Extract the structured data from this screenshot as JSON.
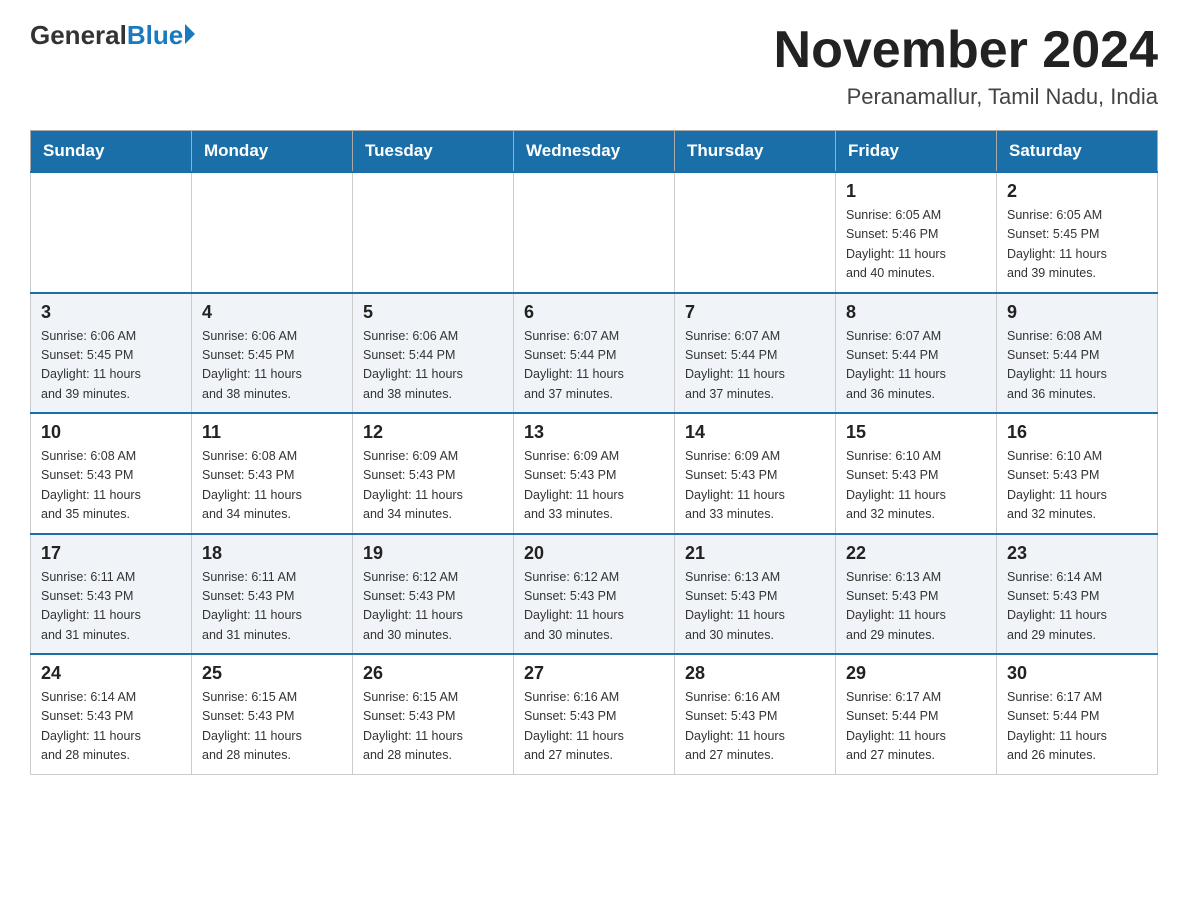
{
  "header": {
    "logo_general": "General",
    "logo_blue": "Blue",
    "month_title": "November 2024",
    "location": "Peranamallur, Tamil Nadu, India"
  },
  "weekdays": [
    "Sunday",
    "Monday",
    "Tuesday",
    "Wednesday",
    "Thursday",
    "Friday",
    "Saturday"
  ],
  "weeks": [
    [
      {
        "day": "",
        "info": ""
      },
      {
        "day": "",
        "info": ""
      },
      {
        "day": "",
        "info": ""
      },
      {
        "day": "",
        "info": ""
      },
      {
        "day": "",
        "info": ""
      },
      {
        "day": "1",
        "info": "Sunrise: 6:05 AM\nSunset: 5:46 PM\nDaylight: 11 hours\nand 40 minutes."
      },
      {
        "day": "2",
        "info": "Sunrise: 6:05 AM\nSunset: 5:45 PM\nDaylight: 11 hours\nand 39 minutes."
      }
    ],
    [
      {
        "day": "3",
        "info": "Sunrise: 6:06 AM\nSunset: 5:45 PM\nDaylight: 11 hours\nand 39 minutes."
      },
      {
        "day": "4",
        "info": "Sunrise: 6:06 AM\nSunset: 5:45 PM\nDaylight: 11 hours\nand 38 minutes."
      },
      {
        "day": "5",
        "info": "Sunrise: 6:06 AM\nSunset: 5:44 PM\nDaylight: 11 hours\nand 38 minutes."
      },
      {
        "day": "6",
        "info": "Sunrise: 6:07 AM\nSunset: 5:44 PM\nDaylight: 11 hours\nand 37 minutes."
      },
      {
        "day": "7",
        "info": "Sunrise: 6:07 AM\nSunset: 5:44 PM\nDaylight: 11 hours\nand 37 minutes."
      },
      {
        "day": "8",
        "info": "Sunrise: 6:07 AM\nSunset: 5:44 PM\nDaylight: 11 hours\nand 36 minutes."
      },
      {
        "day": "9",
        "info": "Sunrise: 6:08 AM\nSunset: 5:44 PM\nDaylight: 11 hours\nand 36 minutes."
      }
    ],
    [
      {
        "day": "10",
        "info": "Sunrise: 6:08 AM\nSunset: 5:43 PM\nDaylight: 11 hours\nand 35 minutes."
      },
      {
        "day": "11",
        "info": "Sunrise: 6:08 AM\nSunset: 5:43 PM\nDaylight: 11 hours\nand 34 minutes."
      },
      {
        "day": "12",
        "info": "Sunrise: 6:09 AM\nSunset: 5:43 PM\nDaylight: 11 hours\nand 34 minutes."
      },
      {
        "day": "13",
        "info": "Sunrise: 6:09 AM\nSunset: 5:43 PM\nDaylight: 11 hours\nand 33 minutes."
      },
      {
        "day": "14",
        "info": "Sunrise: 6:09 AM\nSunset: 5:43 PM\nDaylight: 11 hours\nand 33 minutes."
      },
      {
        "day": "15",
        "info": "Sunrise: 6:10 AM\nSunset: 5:43 PM\nDaylight: 11 hours\nand 32 minutes."
      },
      {
        "day": "16",
        "info": "Sunrise: 6:10 AM\nSunset: 5:43 PM\nDaylight: 11 hours\nand 32 minutes."
      }
    ],
    [
      {
        "day": "17",
        "info": "Sunrise: 6:11 AM\nSunset: 5:43 PM\nDaylight: 11 hours\nand 31 minutes."
      },
      {
        "day": "18",
        "info": "Sunrise: 6:11 AM\nSunset: 5:43 PM\nDaylight: 11 hours\nand 31 minutes."
      },
      {
        "day": "19",
        "info": "Sunrise: 6:12 AM\nSunset: 5:43 PM\nDaylight: 11 hours\nand 30 minutes."
      },
      {
        "day": "20",
        "info": "Sunrise: 6:12 AM\nSunset: 5:43 PM\nDaylight: 11 hours\nand 30 minutes."
      },
      {
        "day": "21",
        "info": "Sunrise: 6:13 AM\nSunset: 5:43 PM\nDaylight: 11 hours\nand 30 minutes."
      },
      {
        "day": "22",
        "info": "Sunrise: 6:13 AM\nSunset: 5:43 PM\nDaylight: 11 hours\nand 29 minutes."
      },
      {
        "day": "23",
        "info": "Sunrise: 6:14 AM\nSunset: 5:43 PM\nDaylight: 11 hours\nand 29 minutes."
      }
    ],
    [
      {
        "day": "24",
        "info": "Sunrise: 6:14 AM\nSunset: 5:43 PM\nDaylight: 11 hours\nand 28 minutes."
      },
      {
        "day": "25",
        "info": "Sunrise: 6:15 AM\nSunset: 5:43 PM\nDaylight: 11 hours\nand 28 minutes."
      },
      {
        "day": "26",
        "info": "Sunrise: 6:15 AM\nSunset: 5:43 PM\nDaylight: 11 hours\nand 28 minutes."
      },
      {
        "day": "27",
        "info": "Sunrise: 6:16 AM\nSunset: 5:43 PM\nDaylight: 11 hours\nand 27 minutes."
      },
      {
        "day": "28",
        "info": "Sunrise: 6:16 AM\nSunset: 5:43 PM\nDaylight: 11 hours\nand 27 minutes."
      },
      {
        "day": "29",
        "info": "Sunrise: 6:17 AM\nSunset: 5:44 PM\nDaylight: 11 hours\nand 27 minutes."
      },
      {
        "day": "30",
        "info": "Sunrise: 6:17 AM\nSunset: 5:44 PM\nDaylight: 11 hours\nand 26 minutes."
      }
    ]
  ]
}
